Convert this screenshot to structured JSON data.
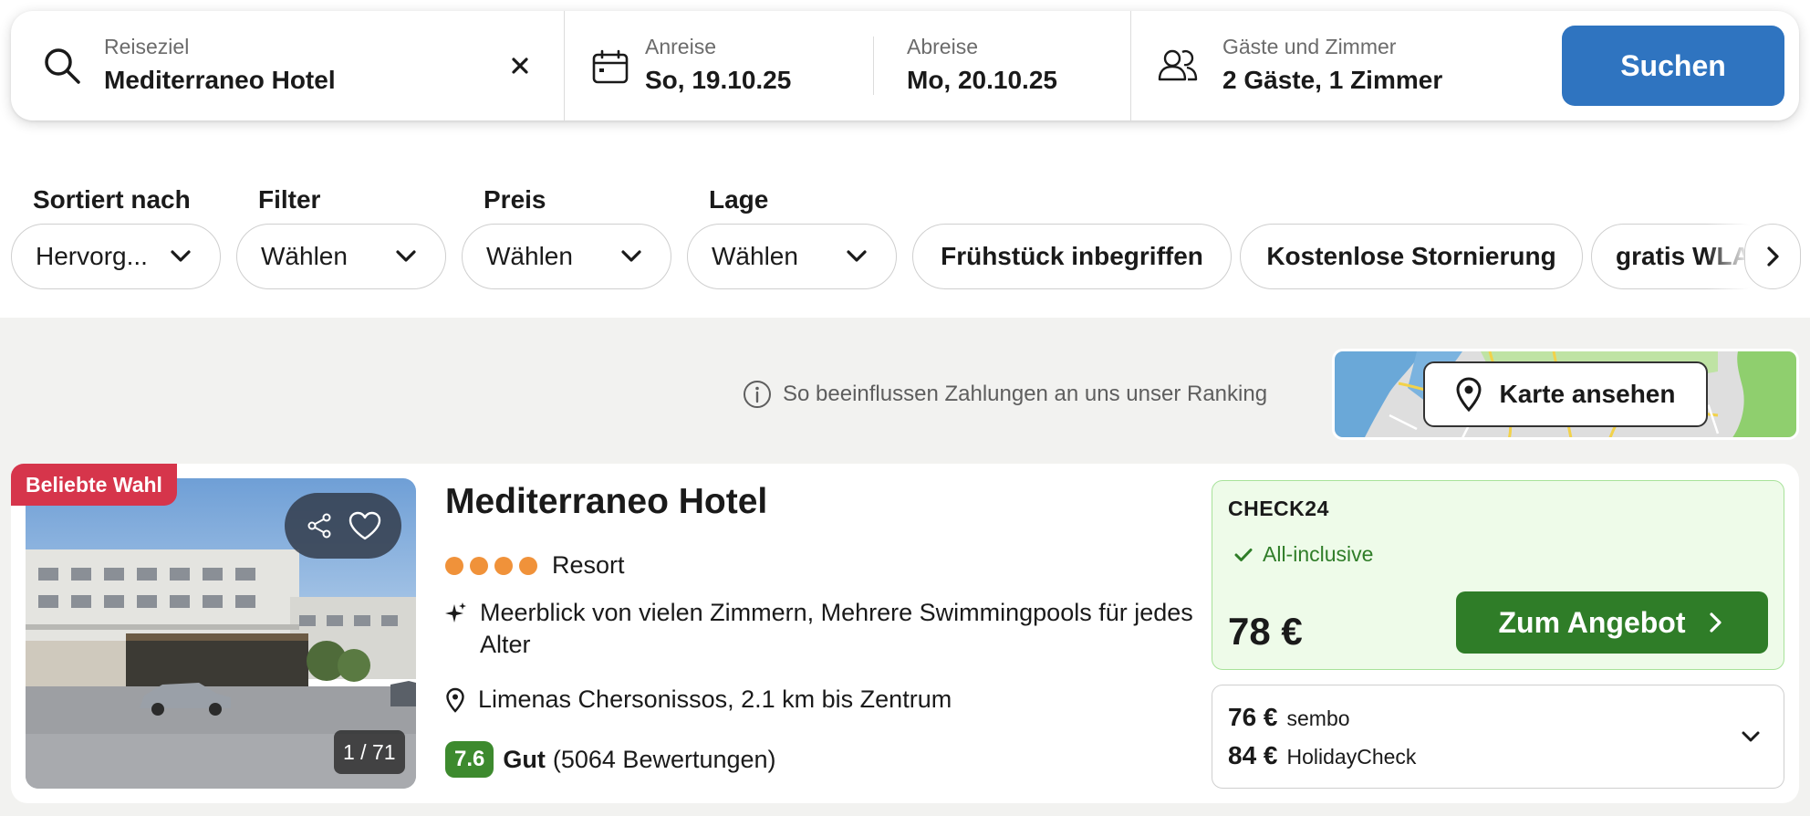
{
  "search": {
    "destination_label": "Reiseziel",
    "destination_value": "Mediterraneo Hotel",
    "checkin_label": "Anreise",
    "checkin_value": "So, 19.10.25",
    "checkout_label": "Abreise",
    "checkout_value": "Mo, 20.10.25",
    "guests_label": "Gäste und Zimmer",
    "guests_value": "2 Gäste, 1 Zimmer",
    "search_button": "Suchen",
    "accent_color": "#2f74c0"
  },
  "filters": {
    "sort": {
      "label": "Sortiert nach",
      "value": "Hervorg..."
    },
    "filter": {
      "label": "Filter",
      "value": "Wählen"
    },
    "price": {
      "label": "Preis",
      "value": "Wählen"
    },
    "location": {
      "label": "Lage",
      "value": "Wählen"
    },
    "chips": [
      "Frühstück inbegriffen",
      "Kostenlose Stornierung",
      "gratis WLAN"
    ]
  },
  "ranking_note": "So beeinflussen Zahlungen an uns unser Ranking",
  "map": {
    "button_label": "Karte ansehen"
  },
  "hotel": {
    "badge": "Beliebte Wahl",
    "photo_counter": "1 / 71",
    "name": "Mediterraneo Hotel",
    "stars": 4,
    "type": "Resort",
    "highlights": "Meerblick von vielen Zimmern, Mehrere Swimmingpools für jedes Alter",
    "location": "Limenas Chersonissos, 2.1 km bis Zentrum",
    "rating_score": "7.6",
    "rating_verdict": "Gut",
    "rating_count": "(5064 Bewertungen)",
    "badge_color": "#d6354b",
    "rating_color": "#3d8a2e"
  },
  "offer": {
    "provider": "CHECK24",
    "board": "All-inclusive",
    "price": "78 €",
    "button": "Zum Angebot",
    "button_color": "#2f7d28"
  },
  "alt_offers": [
    {
      "price": "76 €",
      "provider": "sembo"
    },
    {
      "price": "84 €",
      "provider": "HolidayCheck"
    }
  ]
}
